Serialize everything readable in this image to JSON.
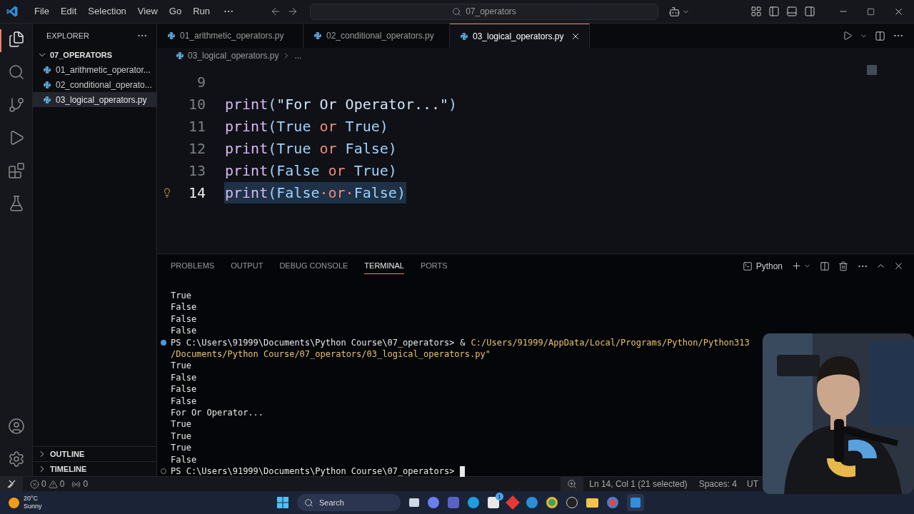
{
  "menu": [
    "File",
    "Edit",
    "Selection",
    "View",
    "Go",
    "Run"
  ],
  "command_center": {
    "label": "07_operators"
  },
  "explorer": {
    "title": "EXPLORER",
    "folder": {
      "name": "07_OPERATORS",
      "expanded": true,
      "children": [
        {
          "name": "01_arithmetic_operator...",
          "selected": false
        },
        {
          "name": "02_conditional_operato...",
          "selected": false
        },
        {
          "name": "03_logical_operators.py",
          "selected": true
        }
      ]
    },
    "sections": [
      {
        "name": "OUTLINE",
        "expanded": false
      },
      {
        "name": "TIMELINE",
        "expanded": false
      }
    ]
  },
  "tabs": [
    {
      "label": "01_arithmetic_operators.py",
      "selected": false
    },
    {
      "label": "02_conditional_operators.py",
      "selected": false
    },
    {
      "label": "03_logical_operators.py",
      "selected": true
    }
  ],
  "breadcrumb": {
    "file": "03_logical_operators.py",
    "rest": "..."
  },
  "editor": {
    "lines": [
      {
        "number": "9",
        "current": false
      },
      {
        "number": "10",
        "current": false,
        "tokens": [
          {
            "kind": "func",
            "text": "print"
          },
          {
            "kind": "paren",
            "text": "("
          },
          {
            "kind": "str",
            "text": "\"For Or Operator...\""
          },
          {
            "kind": "paren",
            "text": ")"
          }
        ]
      },
      {
        "number": "11",
        "current": false,
        "tokens": [
          {
            "kind": "func",
            "text": "print"
          },
          {
            "kind": "paren",
            "text": "("
          },
          {
            "kind": "const",
            "text": "True"
          },
          {
            "kind": "kw",
            "text": " or "
          },
          {
            "kind": "const",
            "text": "True"
          },
          {
            "kind": "paren",
            "text": ")"
          }
        ]
      },
      {
        "number": "12",
        "current": false,
        "tokens": [
          {
            "kind": "func",
            "text": "print"
          },
          {
            "kind": "paren",
            "text": "("
          },
          {
            "kind": "const",
            "text": "True"
          },
          {
            "kind": "kw",
            "text": " or "
          },
          {
            "kind": "const",
            "text": "False"
          },
          {
            "kind": "paren",
            "text": ")"
          }
        ]
      },
      {
        "number": "13",
        "current": false,
        "tokens": [
          {
            "kind": "func",
            "text": "print"
          },
          {
            "kind": "paren",
            "text": "("
          },
          {
            "kind": "const",
            "text": "False"
          },
          {
            "kind": "kw",
            "text": " or "
          },
          {
            "kind": "const",
            "text": "True"
          },
          {
            "kind": "paren",
            "text": ")"
          }
        ]
      },
      {
        "number": "14",
        "current": true,
        "tokens": [
          {
            "kind": "func",
            "text": "print"
          },
          {
            "kind": "paren",
            "text": "("
          },
          {
            "kind": "const",
            "text": "False"
          },
          {
            "kind": "kw",
            "text": "·or·"
          },
          {
            "kind": "const",
            "text": "False"
          },
          {
            "kind": "paren",
            "text": ")"
          }
        ]
      }
    ]
  },
  "panel": {
    "tabs": [
      {
        "label": "PROBLEMS",
        "selected": false
      },
      {
        "label": "OUTPUT",
        "selected": false
      },
      {
        "label": "DEBUG CONSOLE",
        "selected": false
      },
      {
        "label": "TERMINAL",
        "selected": true
      },
      {
        "label": "PORTS",
        "selected": false
      }
    ],
    "terminal_name": "Python",
    "lines": [
      {
        "kind": "output",
        "text": "True"
      },
      {
        "kind": "output",
        "text": "False"
      },
      {
        "kind": "output",
        "text": "False"
      },
      {
        "kind": "output",
        "text": "False"
      },
      {
        "kind": "prompt",
        "finished": true,
        "prompt": "PS C:\\Users\\91999\\Documents\\Python Course\\07_operators>",
        "command": "&",
        "path": "C:/Users/91999/AppData/Local/Programs/Python/Python313"
      },
      {
        "kind": "continuation",
        "text": "/Documents/Python Course/07_operators/03_logical_operators.py\""
      },
      {
        "kind": "output",
        "text": "True"
      },
      {
        "kind": "output",
        "text": "False"
      },
      {
        "kind": "output",
        "text": "False"
      },
      {
        "kind": "output",
        "text": "False"
      },
      {
        "kind": "output",
        "text": "For Or Operator..."
      },
      {
        "kind": "output",
        "text": "True"
      },
      {
        "kind": "output",
        "text": "True"
      },
      {
        "kind": "output",
        "text": "True"
      },
      {
        "kind": "output",
        "text": "False"
      },
      {
        "kind": "prompt",
        "finished": false,
        "prompt": "PS C:\\Users\\91999\\Documents\\Python Course\\07_operators>",
        "cursor": true
      }
    ]
  },
  "status_bar": {
    "errors": "0",
    "warnings": "0",
    "ports": "0",
    "position": "Ln 14, Col 1 (21 selected)",
    "spaces": "Spaces: 4",
    "encoding": "UT"
  },
  "taskbar": {
    "temperature": "20°C",
    "weather": "Sunny",
    "search": "Search",
    "store_badge": "1"
  }
}
